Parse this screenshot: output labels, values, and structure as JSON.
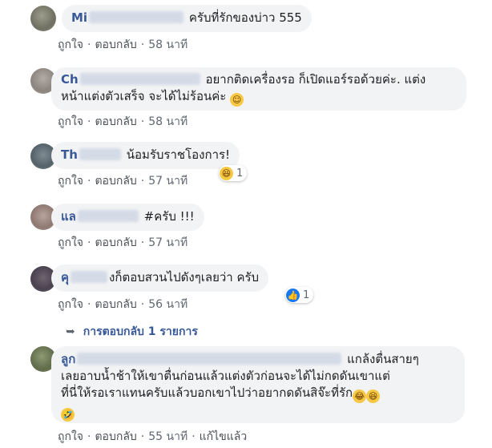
{
  "actions": {
    "like": "ถูกใจ",
    "reply": "ตอบกลับ",
    "separator": "·"
  },
  "comments": [
    {
      "name": "Mi",
      "text": "ครับที่รักของบ่าว 555",
      "time": "58 นาที"
    },
    {
      "name": "Ch",
      "text_line1": "อยากติดเครื่องรอ ก็เปิดแอร์รอด้วยค่ะ. แต่ง",
      "text_line2": "หน้าแต่งตัวเสร็จ จะได้ไม่ร้อนค่ะ",
      "emoji": "smile-emoji",
      "time": "58 นาที"
    },
    {
      "name": "Th",
      "text": "น้อมรับราชโองการ!",
      "time": "57 นาที",
      "reaction": {
        "icon": "laugh-reaction-icon",
        "count": "1"
      }
    },
    {
      "name": "แล",
      "text": "#ครับ !!!",
      "time": "57 นาที"
    },
    {
      "name": "คุ",
      "text": "งก็ตอบสวนไปดังๆเลยว่า ครับ",
      "time": "56 นาที",
      "reaction": {
        "icon": "like-reaction-icon",
        "count": "1"
      }
    },
    {
      "name": "ลูก",
      "text_line1": "แกล้งตื่นสายๆ",
      "text_line2": "เลยอาบน้ำช้าให้เขาตื่นก่อนแล้วแต่งตัวก่อนจะได้ไม่กดดันเขาแต่",
      "text_line3": "ที่นี่ให้รอเราแทนครับแล้วบอกเขาไปว่าอยากดดันสิจ๊ะที่รัก",
      "time": "55 นาที",
      "edited": "แก้ไขแล้ว"
    }
  ],
  "view_replies": "การตอบกลับ 1 รายการ"
}
